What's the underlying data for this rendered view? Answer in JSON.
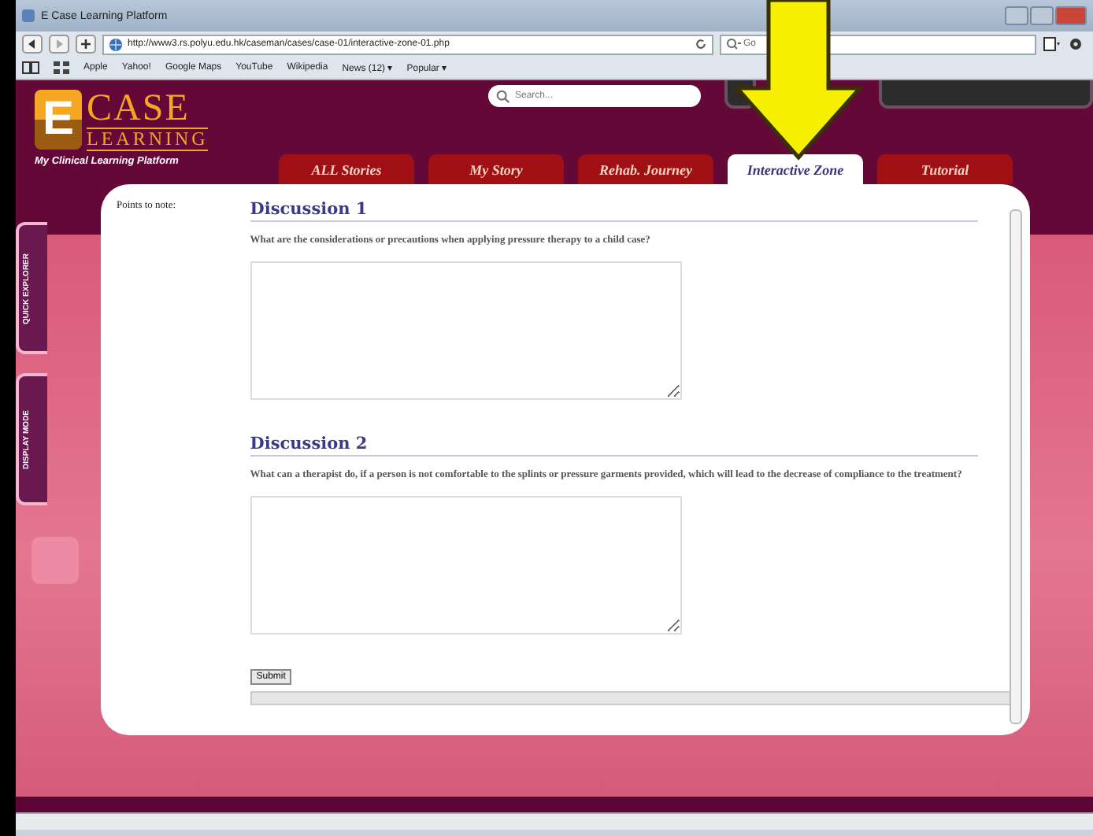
{
  "window": {
    "title": "E Case Learning Platform"
  },
  "toolbar": {
    "url": "http://www3.rs.polyu.edu.hk/caseman/cases/case-01/interactive-zone-01.php",
    "search_value": "Go"
  },
  "bookmarks": [
    "Apple",
    "Yahoo!",
    "Google Maps",
    "YouTube",
    "Wikipedia",
    "News (12) ▾",
    "Popular ▾"
  ],
  "logo": {
    "letter": "E",
    "word_1": "CASE",
    "word_2": "LEARNING",
    "tagline": "My Clinical Learning Platform"
  },
  "search": {
    "placeholder": "Search..."
  },
  "tabs": [
    {
      "label": "ALL Stories",
      "selected": false
    },
    {
      "label": "My Story",
      "selected": false
    },
    {
      "label": "Rehab. Journey",
      "selected": false
    },
    {
      "label": "Interactive Zone",
      "selected": true
    },
    {
      "label": "Tutorial",
      "selected": false
    }
  ],
  "side_tabs": [
    "QUICK EXPLORER",
    "DISPLAY MODE"
  ],
  "content": {
    "points_label": "Points to note:",
    "discussions": [
      {
        "title": "Discussion 1",
        "question": "What are the considerations or precautions when applying pressure therapy to a child case?"
      },
      {
        "title": "Discussion 2",
        "question": "What can a therapist do, if a person is not comfortable to the splints or pressure garments provided, which will lead to the decrease of compliance to the treatment?"
      }
    ],
    "submit": "Submit"
  }
}
